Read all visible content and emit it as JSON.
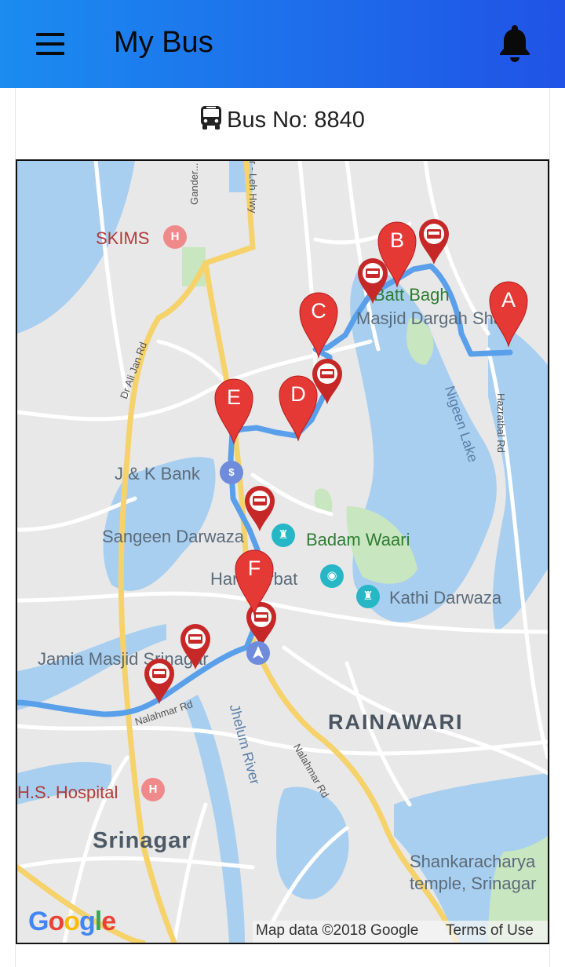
{
  "header": {
    "title": "My Bus",
    "accent_start": "#1b8cf0",
    "accent_end": "#2053e6",
    "menu_icon": "hamburger-menu-icon",
    "notification_icon": "bell-icon"
  },
  "bus": {
    "icon": "bus-icon",
    "label": "Bus No: 8840"
  },
  "map": {
    "places": {
      "skims": "SKIMS",
      "batt_bagh": "Batt Bagh",
      "masjid_dargah": "Masjid Dargah Sharif",
      "jk_bank": "J & K Bank",
      "sangeen_darwaza": "Sangeen Darwaza",
      "badam_waari": "Badam Waari",
      "hari_parbat": "Hari Parbat",
      "kathi_darwaza": "Kathi Darwaza",
      "jamia_masjid": "Jamia Masjid Srinagar",
      "rainawari": "RAINAWARI",
      "hs_hospital": "H.S. Hospital",
      "srinagar": "Srinagar",
      "shankaracharya_1": "Shankaracharya",
      "shankaracharya_2": "temple, Srinagar",
      "nigeen_lake": "Nigeen Lake",
      "jhelum_river": "Jhelum River"
    },
    "roads": {
      "gander": "Gander...",
      "leh_hwy": "r - Leh Hwy",
      "dr_ali_jan": "Dr Ali Jan Rd",
      "hazratbal": "Hazratbal Rd",
      "nalahmar_1": "Nalahmar Rd",
      "nalahmar_2": "Nalahmar Rd"
    },
    "stops": [
      "A",
      "B",
      "C",
      "D",
      "E",
      "F"
    ],
    "attribution": {
      "logo": "Google",
      "map_data": "Map data ©2018 Google",
      "terms": "Terms of Use"
    },
    "route_color": "#5a9fea",
    "marker_color": "#e53935"
  }
}
